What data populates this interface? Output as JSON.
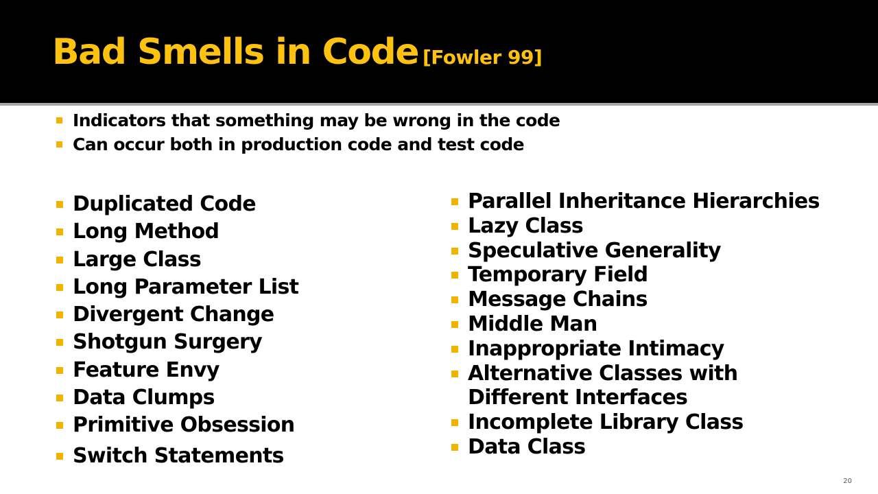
{
  "slide": {
    "title": "Bad Smells in Code",
    "title_ref": "[Fowler 99]",
    "intro": [
      "Indicators that something may be wrong in the code",
      "Can occur both in production code and test code"
    ],
    "left_list": [
      "Duplicated Code",
      "Long Method",
      "Large Class",
      "Long Parameter List",
      "Divergent Change",
      "Shotgun Surgery",
      "Feature Envy",
      "Data Clumps",
      "Primitive Obsession",
      "Switch Statements"
    ],
    "right_list": [
      "Parallel Inheritance Hierarchies",
      "Lazy Class",
      "Speculative Generality",
      "Temporary Field",
      "Message Chains",
      "Middle Man",
      "Inappropriate Intimacy",
      "Alternative Classes with",
      "Different Interfaces",
      "Incomplete Library Class",
      "Data Class"
    ],
    "page_number": "20"
  },
  "colors": {
    "header_bg": "#000000",
    "title": "#fdc20f",
    "bullet": "#f0b400",
    "text": "#000000"
  }
}
